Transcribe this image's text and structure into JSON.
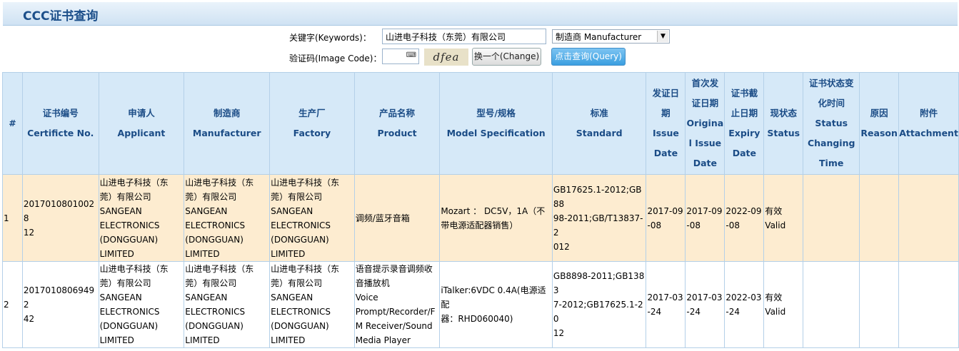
{
  "title": "CCC证书查询",
  "form": {
    "keywords_label": "关键字(Keywords)：",
    "keywords_value": "山进电子科技（东莞）有限公司",
    "select_value": "制造商 Manufacturer",
    "code_label": "验证码(Image Code)：",
    "code_value": "",
    "captcha_text": "dfea",
    "change_label": "换一个(Change)",
    "query_label": "点击查询(Query)"
  },
  "columns": [
    {
      "key": "num",
      "lines": [
        "#"
      ]
    },
    {
      "key": "cert",
      "lines": [
        "证书编号",
        "Certificte No."
      ]
    },
    {
      "key": "applicant",
      "lines": [
        "申请人",
        "Applicant"
      ]
    },
    {
      "key": "manufacturer",
      "lines": [
        "制造商",
        "Manufacturer"
      ]
    },
    {
      "key": "factory",
      "lines": [
        "生产厂",
        "Factory"
      ]
    },
    {
      "key": "product",
      "lines": [
        "产品名称",
        "Product"
      ]
    },
    {
      "key": "model",
      "lines": [
        "型号/规格",
        "Model Specification"
      ]
    },
    {
      "key": "standard",
      "lines": [
        "标准",
        "Standard"
      ]
    },
    {
      "key": "issue",
      "lines": [
        "发证日",
        "期",
        "Issue",
        "Date"
      ]
    },
    {
      "key": "orig",
      "lines": [
        "首次发",
        "证日期",
        "Origina",
        "l Issue",
        "Date"
      ]
    },
    {
      "key": "expiry",
      "lines": [
        "证书截",
        "止日期",
        "Expiry",
        "Date"
      ]
    },
    {
      "key": "status",
      "lines": [
        "现状态",
        "Status"
      ]
    },
    {
      "key": "change",
      "lines": [
        "证书状态变",
        "化时间",
        "Status",
        "Changing",
        "Time"
      ]
    },
    {
      "key": "reason",
      "lines": [
        "原因",
        "Reason"
      ]
    },
    {
      "key": "attach",
      "lines": [
        "附件",
        "Attachment"
      ]
    }
  ],
  "rows": [
    {
      "num": "1",
      "cert": [
        "20170108010028",
        "12"
      ],
      "applicant": [
        "山进电子科技（东",
        "莞）有限公司",
        "SANGEAN",
        "ELECTRONICS",
        "(DONGGUAN)",
        "LIMITED"
      ],
      "manufacturer": [
        "山进电子科技（东",
        "莞）有限公司",
        "SANGEAN",
        "ELECTRONICS",
        "(DONGGUAN)",
        "LIMITED"
      ],
      "factory": [
        "山进电子科技（东",
        "莞）有限公司",
        "SANGEAN",
        "ELECTRONICS",
        "(DONGGUAN)",
        "LIMITED"
      ],
      "product": [
        "调频/蓝牙音箱"
      ],
      "model": [
        "Mozart ： DC5V，1A（不",
        "带电源适配器销售）"
      ],
      "standard": [
        "GB17625.1-2012;GB88",
        "98-2011;GB/T13837-2",
        "012"
      ],
      "issue": [
        "2017-09",
        "-08"
      ],
      "orig": [
        "2017-09",
        "-08"
      ],
      "expiry": [
        "2022-09",
        "-08"
      ],
      "status": [
        "有效",
        "Valid"
      ],
      "change": [],
      "reason": [],
      "attach": []
    },
    {
      "num": "2",
      "cert": [
        "20170108069492",
        "42"
      ],
      "applicant": [
        "山进电子科技（东",
        "莞）有限公司",
        "SANGEAN",
        "ELECTRONICS",
        "(DONGGUAN)",
        "LIMITED"
      ],
      "manufacturer": [
        "山进电子科技（东",
        "莞）有限公司",
        "SANGEAN",
        "ELECTRONICS",
        "(DONGGUAN)",
        "LIMITED"
      ],
      "factory": [
        "山进电子科技（东",
        "莞）有限公司",
        "SANGEAN",
        "ELECTRONICS",
        "(DONGGUAN)",
        "LIMITED"
      ],
      "product": [
        "语音提示录音调频收",
        "音播放机",
        "Voice",
        "Prompt/Recorder/F",
        "M Receiver/Sound",
        "Media Player"
      ],
      "model": [
        "iTalker:6VDC 0.4A(电源适配",
        "器：RHD060040)"
      ],
      "standard": [
        "GB8898-2011;GB1383",
        "7-2012;GB17625.1-20",
        "12"
      ],
      "issue": [
        "2017-03",
        "-24"
      ],
      "orig": [
        "2017-03",
        "-24"
      ],
      "expiry": [
        "2022-03",
        "-24"
      ],
      "status": [
        "有效",
        "Valid"
      ],
      "change": [],
      "reason": [],
      "attach": []
    }
  ]
}
